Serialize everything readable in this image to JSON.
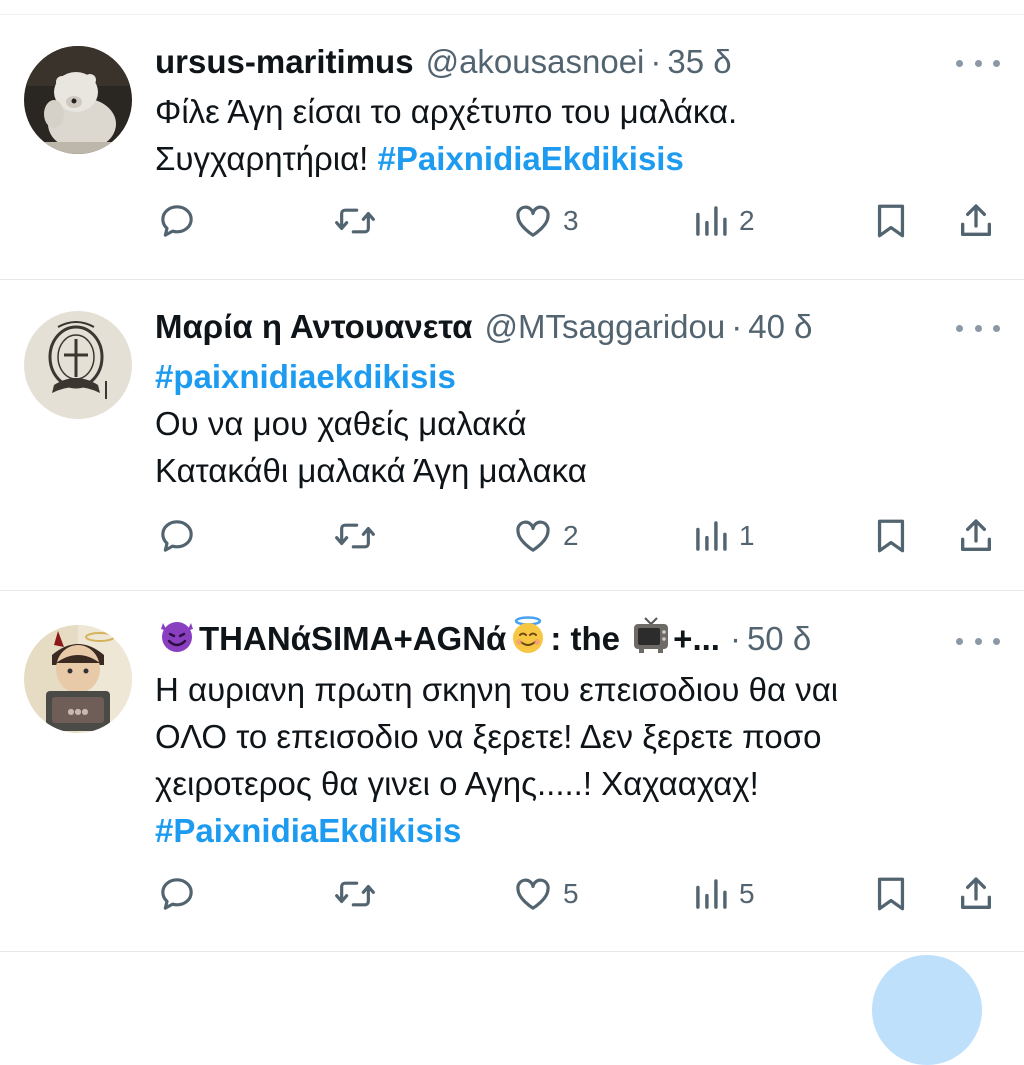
{
  "tweets": [
    {
      "name": "ursus-maritimus",
      "handle": "@akousasnoei",
      "separator": "·",
      "time": "35 δ",
      "avatar_icon": "polar-bear-avatar",
      "body_lines": [
        {
          "text": "Φίλε Άγη είσαι το αρχέτυπο του μαλάκα.",
          "hashtag": ""
        },
        {
          "text": "Συγχαρητήρια! ",
          "hashtag": "#PaixnidiaEkdikisis"
        }
      ],
      "stats": {
        "replies": "",
        "retweets": "",
        "likes": "3",
        "views": "2"
      }
    },
    {
      "name": "Μαρία η Αντουανετα",
      "handle": "@MTsaggaridou",
      "separator": "·",
      "time": "40 δ",
      "avatar_icon": "engraved-emblem-avatar",
      "body_lines": [
        {
          "text": "",
          "hashtag": "#paixnidiaekdikisis"
        },
        {
          "text": "Ου να μου χαθείς μαλακά",
          "hashtag": ""
        },
        {
          "text": "Κατακάθι μαλακά Άγη μαλακα",
          "hashtag": ""
        }
      ],
      "stats": {
        "replies": "",
        "retweets": "",
        "likes": "2",
        "views": "1"
      }
    },
    {
      "name_parts": {
        "part1": "THANάSIMA+AGNά",
        "part2": ": the ",
        "part3": "+..."
      },
      "handle": "",
      "separator": "·",
      "time": "50 δ",
      "avatar_icon": "angel-devil-boy-avatar",
      "emoji_icons": [
        "smiling-devil-emoji",
        "halo-face-emoji",
        "television-emoji"
      ],
      "body_lines": [
        {
          "text": "Η αυριανη πρωτη σκηνη του επεισοδιου θα ναι",
          "hashtag": ""
        },
        {
          "text": "ΟΛΟ το επεισοδιο να ξερετε! Δεν ξερετε ποσο",
          "hashtag": ""
        },
        {
          "text": "χειροτερος θα γινει ο Αγης.....! Χαχααχαχ!",
          "hashtag": ""
        },
        {
          "text": "",
          "hashtag": "#PaixnidiaEkdikisis"
        }
      ],
      "stats": {
        "replies": "",
        "retweets": "",
        "likes": "5",
        "views": "5"
      }
    }
  ],
  "colors": {
    "hashtag": "#1d9bf0",
    "secondary_text": "#536471",
    "icon": "#536471"
  }
}
